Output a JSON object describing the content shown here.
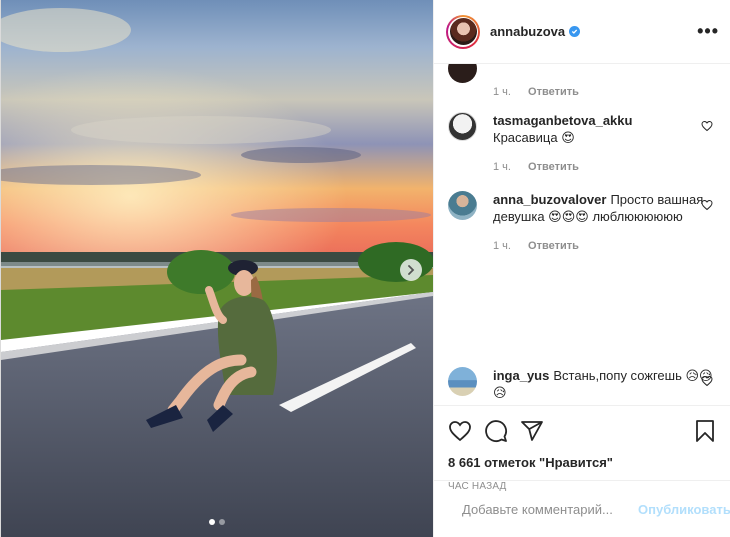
{
  "post": {
    "author": "annabuzova",
    "likes_text": "8 661 отметок \"Нравится\"",
    "time_text": "ЧАС НАЗАД",
    "carousel": {
      "slide_count": 2,
      "active_index": 0
    }
  },
  "comments": [
    {
      "user": "",
      "text": "",
      "time": "1 ч.",
      "reply": "Ответить"
    },
    {
      "user": "tasmaganbetova_akku",
      "text": "Красавица 😍",
      "time": "1 ч.",
      "reply": "Ответить"
    },
    {
      "user": "anna_buzovalover",
      "text": "Просто вашная девушка 😍😍😍 люблюююююю",
      "time": "1 ч.",
      "reply": "Ответить"
    },
    {
      "user": "inga_yus",
      "text": "Встань,попу сожгешь 😥😥😥",
      "time": "",
      "reply": ""
    }
  ],
  "add_comment": {
    "placeholder": "Добавьте комментарий...",
    "publish_label": "Опубликовать"
  },
  "colors": {
    "verified": "#3897f0",
    "publish_disabled": "#b2dffc",
    "muted": "#8e8e8e"
  }
}
